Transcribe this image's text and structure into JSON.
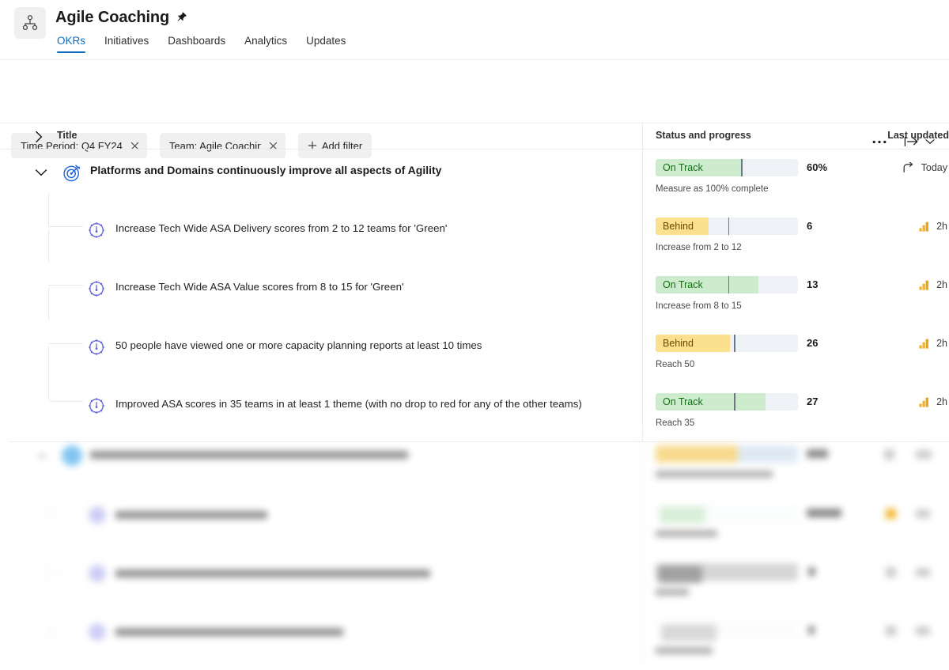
{
  "header": {
    "app_icon": "org-hierarchy-icon",
    "title": "Agile Coaching",
    "pin_icon": "pin-icon",
    "tabs": [
      {
        "label": "OKRs",
        "active": true
      },
      {
        "label": "Initiatives",
        "active": false
      },
      {
        "label": "Dashboards",
        "active": false
      },
      {
        "label": "Analytics",
        "active": false
      },
      {
        "label": "Updates",
        "active": false
      }
    ]
  },
  "filters": {
    "chips": [
      {
        "label": "Time Period: Q4 FY24",
        "close_icon": "close-icon"
      },
      {
        "label": "Team:  Agile Coaching",
        "close_icon": "close-icon"
      }
    ],
    "add_filter_label": "Add filter",
    "add_filter_icon": "plus-icon",
    "more_icon": "ellipsis-icon",
    "collapse_icon": "collapse-all-icon",
    "chevron_icon": "chevron-down-icon"
  },
  "table": {
    "columns": {
      "expand_icon": "chevron-right-icon",
      "title": "Title",
      "status": "Status and progress",
      "updated": "Last updated"
    },
    "objective": {
      "expand_icon": "chevron-down-icon",
      "icon": "objective-target-icon",
      "title": "Platforms and Domains continuously improve all aspects of Agility",
      "status_label": "On Track",
      "status_color": "#cdeccd",
      "status_text_color": "#0e700e",
      "progress_percent": 60,
      "target_marker_percent": 60,
      "value": "60%",
      "subtitle": "Measure as 100% complete",
      "updated_icon": "share-arrow-icon",
      "updated": "Today"
    },
    "key_results": [
      {
        "icon": "gauge-icon",
        "title": "Increase Tech Wide ASA Delivery scores from 2 to 12 teams for 'Green'",
        "status_label": "Behind",
        "status_color": "#fbe08e",
        "status_text_color": "#6b4b00",
        "progress_percent": 37,
        "target_marker_percent": 51,
        "value": "6",
        "subtitle": "Increase from 2 to 12",
        "updated_icon": "bar-chart-icon",
        "updated": "2h"
      },
      {
        "icon": "gauge-icon",
        "title": "Increase Tech Wide ASA Value scores from 8 to 15 for 'Green'",
        "status_label": "On Track",
        "status_color": "#cdeccd",
        "status_text_color": "#0e700e",
        "progress_percent": 72,
        "target_marker_percent": 51,
        "value": "13",
        "subtitle": "Increase from 8 to 15",
        "updated_icon": "bar-chart-icon",
        "updated": "2h"
      },
      {
        "icon": "gauge-icon",
        "title": "50 people have viewed one or more capacity planning reports at least 10 times",
        "status_label": "Behind",
        "status_color": "#fbe08e",
        "status_text_color": "#6b4b00",
        "progress_percent": 52,
        "target_marker_percent": 55,
        "value": "26",
        "subtitle": "Reach 50",
        "updated_icon": "bar-chart-icon",
        "updated": "2h"
      },
      {
        "icon": "gauge-icon",
        "title": "Improved ASA scores in 35 teams in at least 1 theme (with no drop to red for any of the other teams)",
        "status_label": "On Track",
        "status_color": "#cdeccd",
        "status_text_color": "#0e700e",
        "progress_percent": 77,
        "target_marker_percent": 55,
        "value": "27",
        "subtitle": "Reach 35",
        "updated_icon": "bar-chart-icon",
        "updated": "2h"
      }
    ]
  }
}
